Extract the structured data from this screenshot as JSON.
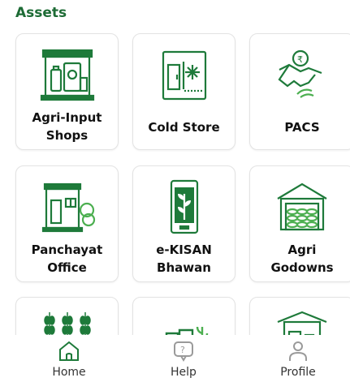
{
  "section": {
    "title": "Assets"
  },
  "cards": [
    {
      "label_line1": "Agri-Input",
      "label_line2": "Shops",
      "icon": "agri-input-shop-icon"
    },
    {
      "label_line1": "Cold Store",
      "label_line2": "",
      "icon": "cold-store-icon"
    },
    {
      "label_line1": "PACS",
      "label_line2": "",
      "icon": "pacs-handshake-icon"
    },
    {
      "label_line1": "Panchayat",
      "label_line2": "Office",
      "icon": "panchayat-office-icon"
    },
    {
      "label_line1": "e-KISAN",
      "label_line2": "Bhawan",
      "icon": "ekisan-phone-plant-icon"
    },
    {
      "label_line1": "Agri",
      "label_line2": "Godowns",
      "icon": "godown-warehouse-icon"
    }
  ],
  "partial_cards": [
    {
      "icon": "wheat-crop-icon"
    },
    {
      "icon": "farm-machinery-icon"
    },
    {
      "icon": "market-shed-icon"
    }
  ],
  "nav": {
    "items": [
      {
        "label": "Home",
        "icon": "home-icon"
      },
      {
        "label": "Help",
        "icon": "help-chat-icon"
      },
      {
        "label": "Profile",
        "icon": "profile-person-icon"
      }
    ]
  },
  "colors": {
    "brand_green": "#1d6b35",
    "icon_green": "#1e7a3a"
  }
}
